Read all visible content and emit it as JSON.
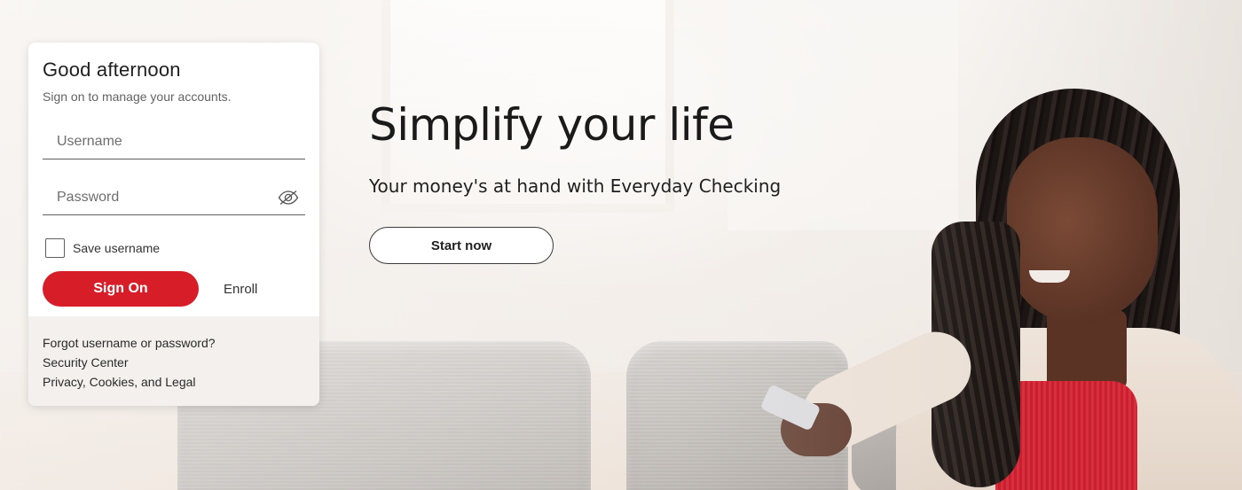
{
  "signon": {
    "greeting": "Good afternoon",
    "subtitle": "Sign on to manage your accounts.",
    "username_placeholder": "Username",
    "username_value": "",
    "password_placeholder": "Password",
    "password_value": "",
    "password_toggle_icon": "eye-slash-icon",
    "save_username_label": "Save username",
    "save_username_checked": false,
    "signon_button": "Sign On",
    "enroll_link": "Enroll",
    "footer_links": [
      "Forgot username or password?",
      "Security Center",
      "Privacy, Cookies, and Legal"
    ]
  },
  "hero": {
    "headline": "Simplify your life",
    "subhead": "Your money's at hand with Everyday Checking",
    "cta_button": "Start now"
  },
  "colors": {
    "brand_red": "#d71e28",
    "text_dark": "#1a1a1a",
    "footer_bg": "#f3f0ed"
  }
}
